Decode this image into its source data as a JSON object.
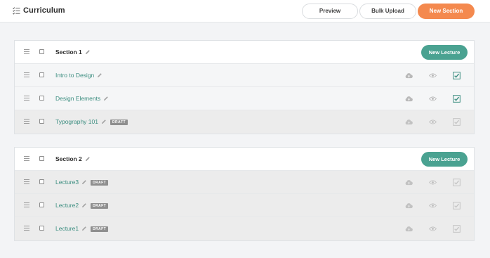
{
  "header": {
    "title": "Curriculum",
    "preview_label": "Preview",
    "bulk_upload_label": "Bulk Upload",
    "new_section_label": "New Section"
  },
  "colors": {
    "accent_orange": "#f4894e",
    "accent_teal": "#4aa291",
    "lecture_link": "#3c8e80"
  },
  "sections": [
    {
      "title": "Section 1",
      "new_lecture_label": "New Lecture",
      "lectures": [
        {
          "title": "Intro to Design",
          "status": "published",
          "badge": ""
        },
        {
          "title": "Design Elements",
          "status": "published",
          "badge": ""
        },
        {
          "title": "Typography 101",
          "status": "draft",
          "badge": "DRAFT"
        }
      ]
    },
    {
      "title": "Section 2",
      "new_lecture_label": "New Lecture",
      "lectures": [
        {
          "title": "Lecture3",
          "status": "draft",
          "badge": "DRAFT"
        },
        {
          "title": "Lecture2",
          "status": "draft",
          "badge": "DRAFT"
        },
        {
          "title": "Lecture1",
          "status": "draft",
          "badge": "DRAFT"
        }
      ]
    }
  ],
  "icons": {
    "header": "curriculum-list-icon",
    "drag": "drag-handle-icon",
    "edit": "pencil-icon",
    "upload": "cloud-upload-icon",
    "preview": "eye-icon",
    "publish": "publish-check-icon"
  }
}
